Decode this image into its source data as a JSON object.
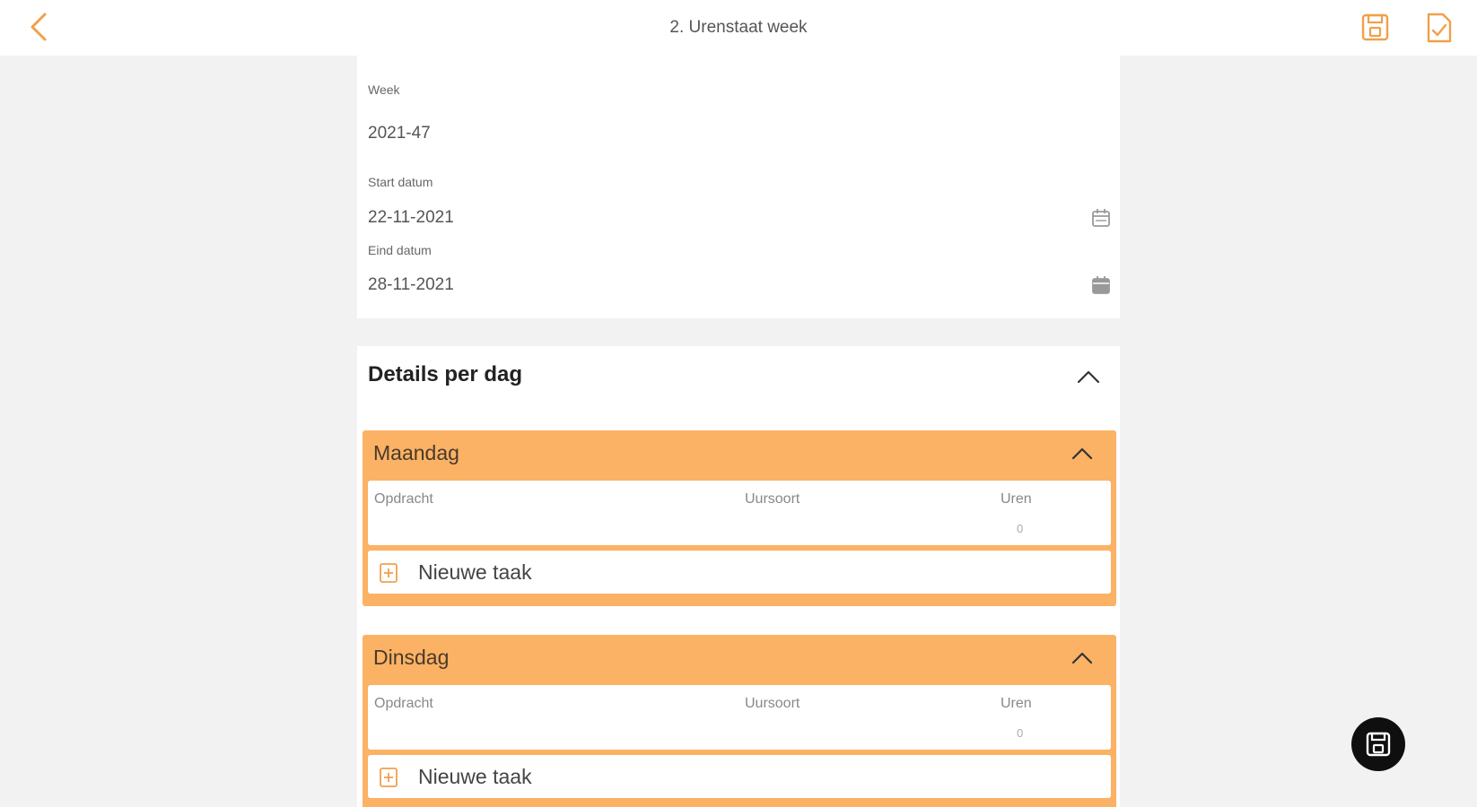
{
  "header": {
    "title": "2. Urenstaat week",
    "back_icon": "chevron-left-icon",
    "save_icon": "save-icon",
    "submit_icon": "document-check-icon"
  },
  "form": {
    "week_label": "Week",
    "week_value": "2021-47",
    "start_label": "Start datum",
    "start_value": "22-11-2021",
    "end_label": "Eind datum",
    "end_value": "28-11-2021"
  },
  "details": {
    "title": "Details per dag",
    "days": [
      {
        "name": "Maandag",
        "col_opdracht": "Opdracht",
        "col_uursoort": "Uursoort",
        "col_uren": "Uren",
        "uren_value": "0",
        "new_task_label": "Nieuwe taak"
      },
      {
        "name": "Dinsdag",
        "col_opdracht": "Opdracht",
        "col_uursoort": "Uursoort",
        "col_uren": "Uren",
        "uren_value": "0",
        "new_task_label": "Nieuwe taak"
      }
    ]
  },
  "colors": {
    "accent": "#f0a04b",
    "day_header": "#fbb265",
    "fab": "#0f0f0f",
    "background": "#f2f2f2"
  }
}
